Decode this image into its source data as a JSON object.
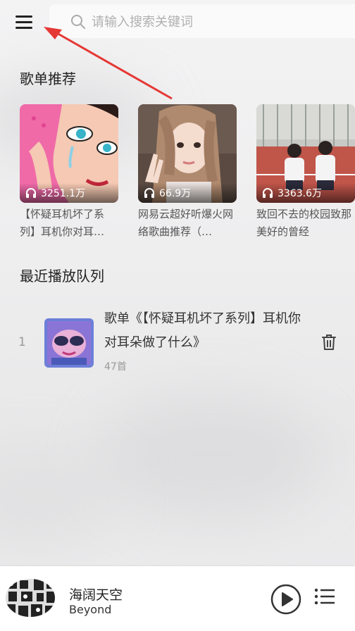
{
  "search": {
    "placeholder": "请输入搜索关键词"
  },
  "sections": {
    "recommend_title": "歌单推荐",
    "queue_title": "最近播放队列"
  },
  "playlists": [
    {
      "plays": "3251.1万",
      "title": "【怀疑耳机坏了系列】耳机你对耳…",
      "cover": "pop-art-crying-girl"
    },
    {
      "plays": "66.9万",
      "title": "网易云超好听爆火网络歌曲推荐（…",
      "cover": "girl-peace-sign"
    },
    {
      "plays": "3363.6万",
      "title": "致回不去的校园致那美好的曾经",
      "cover": "students-on-track"
    }
  ],
  "queue": [
    {
      "index": "1",
      "title": "歌单《【怀疑耳机坏了系列】耳机你对耳朵做了什么》",
      "count": "47首"
    }
  ],
  "player": {
    "song": "海阔天空",
    "artist": "Beyond"
  },
  "colors": {
    "arrow": "#e53935",
    "icon": "#333333"
  },
  "icons": [
    "menu-icon",
    "search-icon",
    "headphones-icon",
    "trash-icon",
    "play-icon",
    "playlist-icon"
  ]
}
